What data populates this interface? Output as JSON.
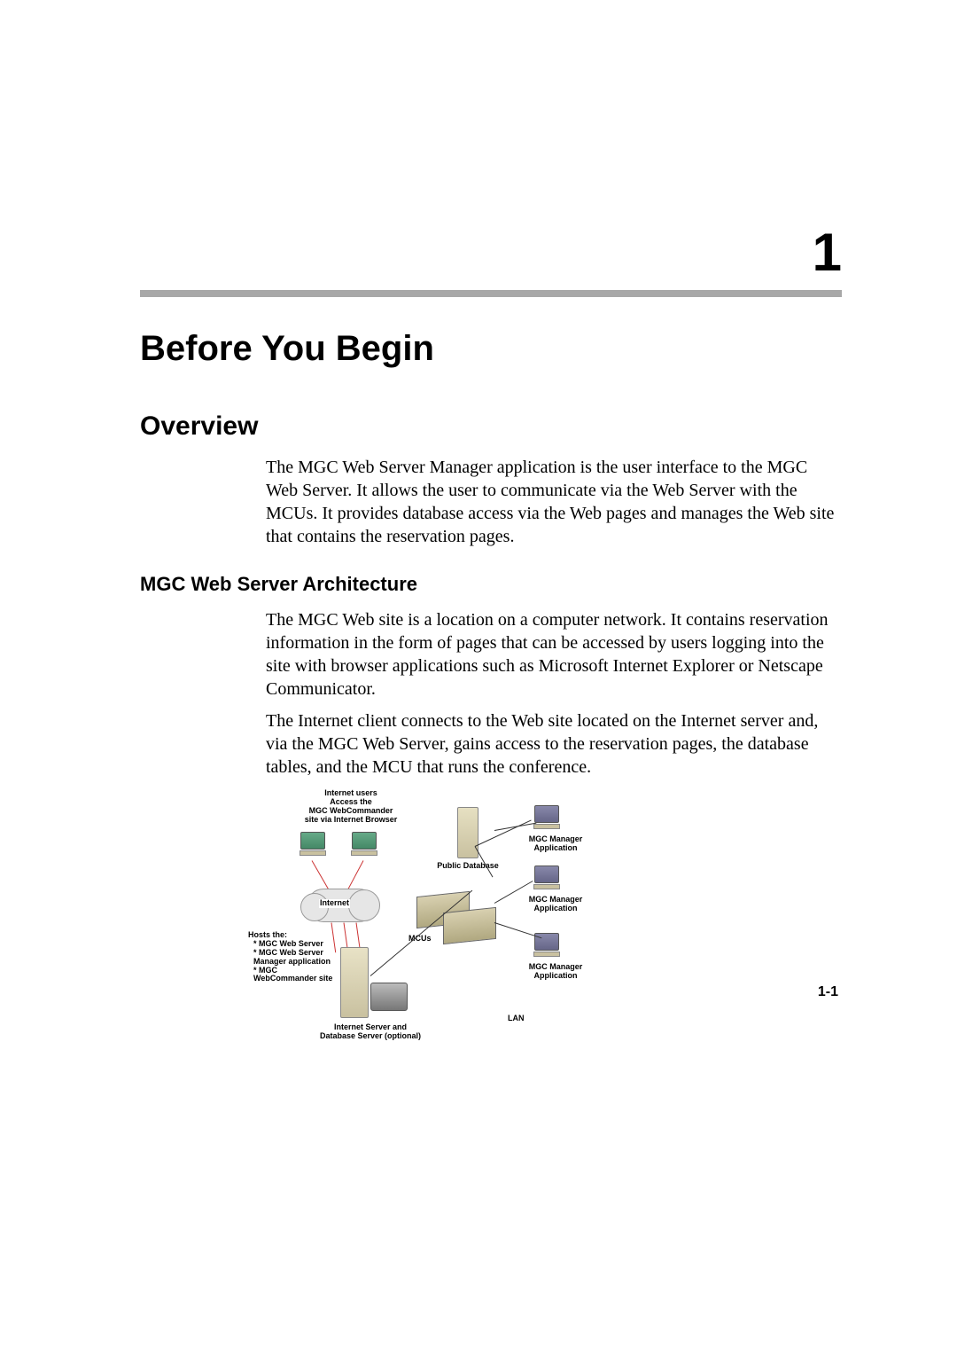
{
  "chapter": {
    "number": "1",
    "title": "Before You Begin"
  },
  "section": {
    "title": "Overview"
  },
  "overview_paragraph": "The MGC Web Server Manager application is the user interface to the MGC Web Server. It allows the user to communicate via the Web Server with the MCUs. It provides database access via the Web pages and manages the Web site that contains the reservation pages.",
  "subsection": {
    "title": "MGC Web Server Architecture"
  },
  "arch_paragraph_1": "The MGC Web site is a location on a computer network. It contains reservation information in the form of pages that can be accessed by users logging into the site with browser applications such as Microsoft Internet Explorer or Netscape Communicator.",
  "arch_paragraph_2": "The Internet client connects to the Web site located on the Internet server and, via the MGC Web Server, gains access to the reservation pages, the database tables, and the MCU that runs the conference.",
  "diagram": {
    "internet_users_line1": "Internet users",
    "internet_users_line2": "Access the",
    "internet_users_line3": "MGC WebCommander",
    "internet_users_line4": "site via Internet Browser",
    "internet_label": "Internet",
    "public_database": "Public Database",
    "mcus": "MCUs",
    "mgc_manager_application": "MGC Manager Application",
    "lan": "LAN",
    "hosts_title": "Hosts the:",
    "hosts_item1": "MGC Web Server",
    "hosts_item2": "MGC Web Server Manager application",
    "hosts_item3": "MGC WebCommander site",
    "internet_server_line1": "Internet Server and",
    "internet_server_line2": "Database Server (optional)"
  },
  "page_number": "1-1"
}
